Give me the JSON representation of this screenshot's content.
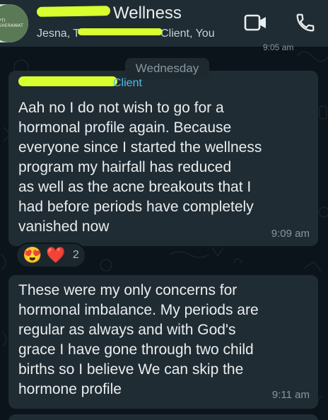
{
  "header": {
    "title_suffix": "Wellness",
    "avatar_text": "PTI SHERAWAT",
    "subtitle_prefix": "Jesna, T",
    "subtitle_suffix": "Client, You"
  },
  "peek_time": "9:05 am",
  "date_chip": "Wednesday",
  "messages": [
    {
      "sender_suffix": "Client",
      "text": "Aah no I do not wish to go for a\nhormonal profile again. Because\neveryone since I started the wellness\nprogram my hairfall has reduced\nas well as the acne breakouts that I\nhad before periods have completely\nvanished now",
      "time": "9:09 am",
      "reactions": {
        "emojis": [
          "😍",
          "❤️"
        ],
        "count": "2"
      }
    },
    {
      "text": "These were my only concerns for\nhormonal imbalance. My periods are\nregular as always and  with God's\ngrace I have gone through two child\nbirths so I believe We can skip the\nhormone profile",
      "time": "9:11 am"
    }
  ],
  "colors": {
    "header_bg": "#1f2c34",
    "chat_bg": "#0b141a",
    "bubble_bg": "#202c33",
    "sender_color": "#53bdeb",
    "redaction": "#d8ff2e"
  },
  "icons": [
    "video-call-icon",
    "voice-call-icon"
  ]
}
